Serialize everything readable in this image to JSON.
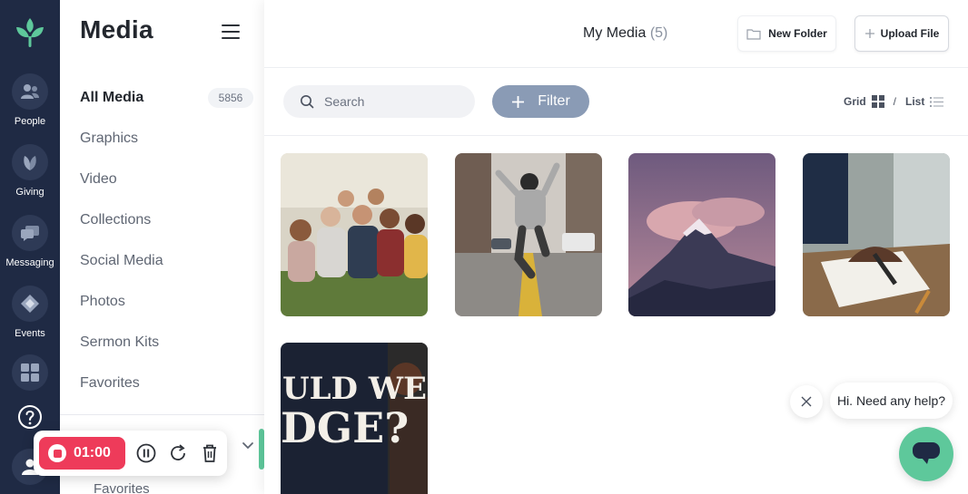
{
  "rail": {
    "items": [
      {
        "label": "People",
        "icon": "people-icon"
      },
      {
        "label": "Giving",
        "icon": "leaf-icon"
      },
      {
        "label": "Messaging",
        "icon": "chat-icon"
      },
      {
        "label": "Events",
        "icon": "ticket-icon"
      },
      {
        "label": "",
        "icon": "apps-grid-icon"
      },
      {
        "label": "",
        "icon": "help-icon"
      },
      {
        "label": "",
        "icon": "user-icon"
      }
    ],
    "brand_color": "#1f2a44",
    "accent_color": "#5ec89b"
  },
  "nav": {
    "title": "Media",
    "items": [
      {
        "label": "All Media",
        "count": "5856",
        "active": true
      },
      {
        "label": "Graphics"
      },
      {
        "label": "Video"
      },
      {
        "label": "Collections"
      },
      {
        "label": "Social Media"
      },
      {
        "label": "Photos"
      },
      {
        "label": "Sermon Kits"
      },
      {
        "label": "Favorites"
      }
    ],
    "sub_item": "Favorites"
  },
  "topbar": {
    "title": "My Media",
    "count": "(5)",
    "new_folder_label": "New Folder",
    "upload_label": "Upload File"
  },
  "toolbar": {
    "search_placeholder": "Search",
    "filter_label": "Filter",
    "grid_label": "Grid",
    "separator": "/",
    "list_label": "List"
  },
  "media": [
    {
      "kind": "photo",
      "subject": "group-of-people"
    },
    {
      "kind": "photo",
      "subject": "person-jumping-street"
    },
    {
      "kind": "photo",
      "subject": "mountain-clouds"
    },
    {
      "kind": "photo",
      "subject": "hand-writing"
    },
    {
      "kind": "graphic",
      "subject": "sermon-title",
      "text_line1": "ULD WE",
      "text_line2": "DGE?"
    }
  ],
  "chat": {
    "greeting": "Hi. Need any help?"
  },
  "recorder": {
    "time": "01:00",
    "color": "#ee3b5a"
  }
}
